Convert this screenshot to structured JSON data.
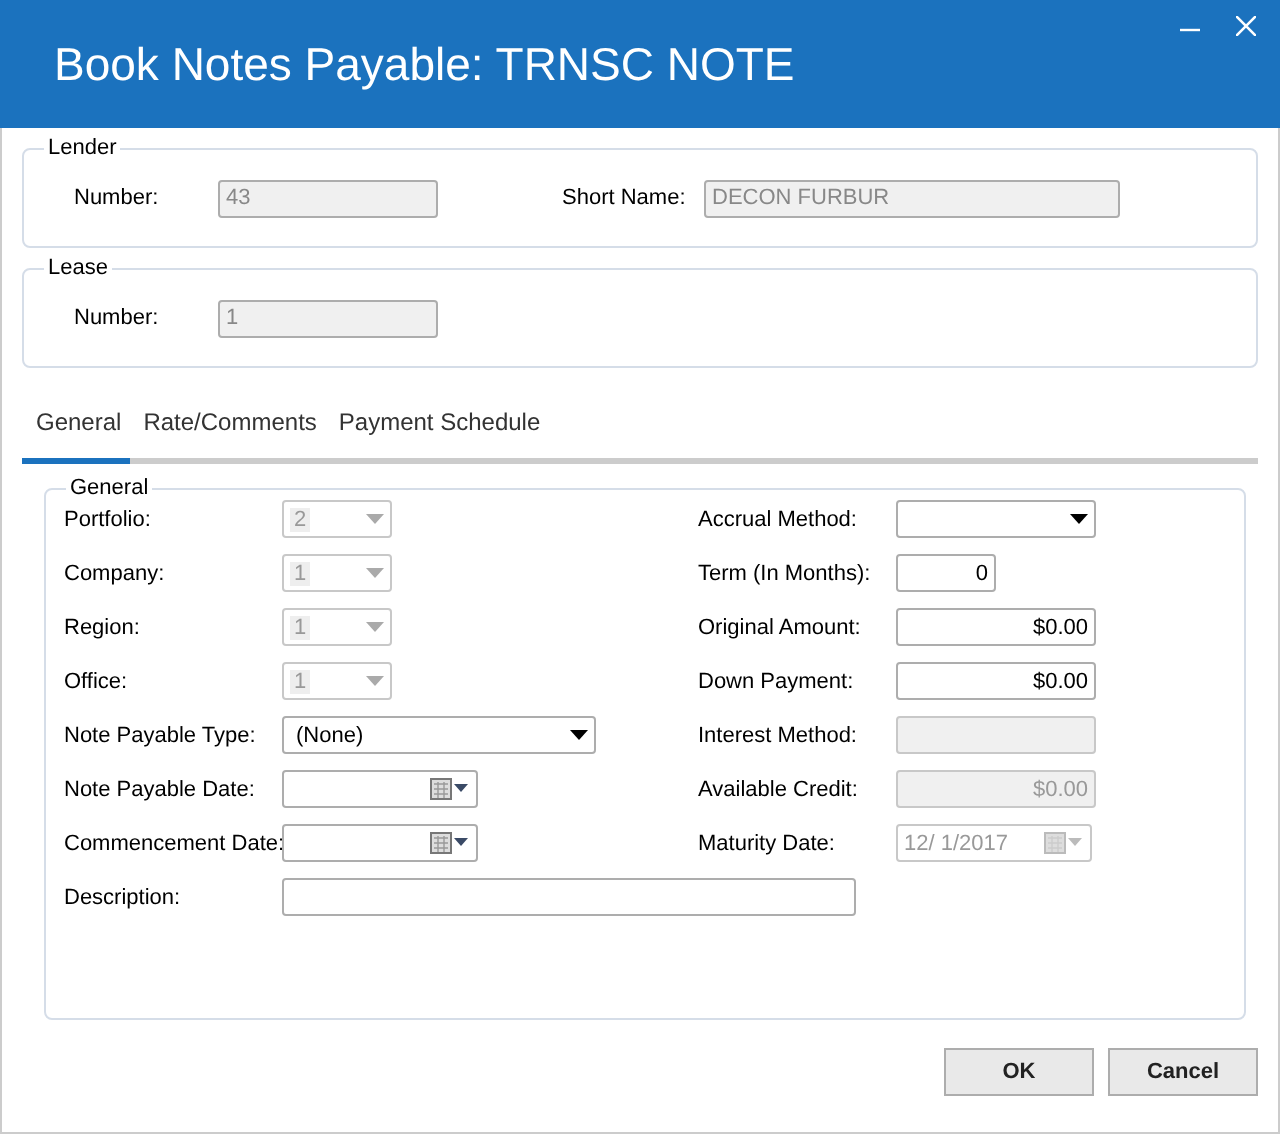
{
  "window": {
    "title": "Book Notes Payable: TRNSC NOTE"
  },
  "lender": {
    "title": "Lender",
    "fields": [
      {
        "label": "Number:",
        "value": "43"
      },
      {
        "label": "Short Name:",
        "value": "DECON FURBUR"
      }
    ]
  },
  "lease": {
    "title": "Lease",
    "fields": [
      {
        "label": "Number:",
        "value": "1"
      }
    ]
  },
  "tabs": [
    {
      "label": "General",
      "selected": true
    },
    {
      "label": "Rate/Comments",
      "selected": false
    },
    {
      "label": "Payment Schedule",
      "selected": false
    }
  ],
  "general": {
    "title": "General",
    "left": [
      {
        "label": "Portfolio:",
        "kind": "combo",
        "value": "2",
        "disabled": true
      },
      {
        "label": "Company:",
        "kind": "combo",
        "value": "1",
        "disabled": true
      },
      {
        "label": "Region:",
        "kind": "combo",
        "value": "1",
        "disabled": true
      },
      {
        "label": "Office:",
        "kind": "combo",
        "value": "1",
        "disabled": true
      },
      {
        "label": "Note Payable Type:",
        "kind": "dropdown",
        "value": "(None)",
        "disabled": false
      },
      {
        "label": "Note Payable Date:",
        "kind": "date",
        "disabled": false
      },
      {
        "label": "Commencement Date:",
        "kind": "date",
        "disabled": false
      },
      {
        "label": "Description:",
        "kind": "text",
        "disabled": false
      }
    ],
    "right": [
      {
        "label": "Accrual Method:",
        "kind": "dropdown",
        "disabled": false
      },
      {
        "label": "Term (In Months):",
        "kind": "short",
        "value": "0",
        "disabled": false
      },
      {
        "label": "Original Amount:",
        "kind": "text",
        "value": "$0.00",
        "disabled": false
      },
      {
        "label": "Down Payment:",
        "kind": "text",
        "value": "$0.00",
        "disabled": false
      },
      {
        "label": "Interest Method:",
        "kind": "text",
        "disabled": true
      },
      {
        "label": "Available Credit:",
        "kind": "text",
        "value": "$0.00",
        "disabled": true
      },
      {
        "label": "Maturity Date:",
        "kind": "date",
        "value": "12/ 1/2017",
        "disabled": true
      }
    ]
  },
  "buttons": [
    "OK",
    "Cancel"
  ]
}
